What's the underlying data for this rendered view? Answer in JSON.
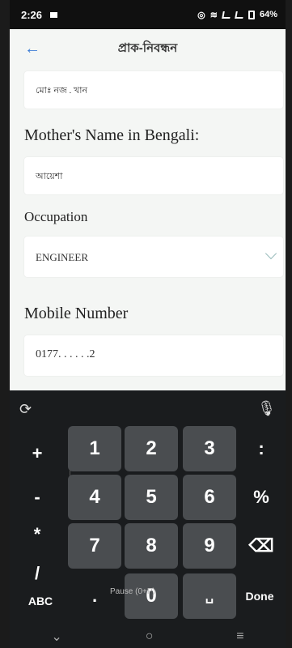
{
  "status_bar": {
    "time": "2:26",
    "battery": "64%"
  },
  "app_bar": {
    "title": "প্রাক-নিবন্ধন"
  },
  "form": {
    "father_name_value": "মোঃ নজ . খান",
    "mother_label": "Mother's Name in Bengali:",
    "mother_value": "আয়েশা",
    "occupation_label": "Occupation",
    "occupation_value": "ENGINEER",
    "mobile_label": "Mobile Number",
    "mobile_value": "0177. . . . . .2"
  },
  "keyboard": {
    "keys": [
      "1",
      "2",
      "3",
      "4",
      "5",
      "6",
      "7",
      "8",
      "9",
      "0"
    ],
    "left": [
      "+",
      "-",
      "*",
      "/"
    ],
    "right": [
      ":",
      "%"
    ],
    "abc": "ABC",
    "dot": ".",
    "done": "Done",
    "tooltip": "Pause (0+P)"
  },
  "icons": {
    "back": "arrow-left-icon",
    "mic": "mic-icon",
    "backspace": "backspace-icon",
    "emoji": "keyboard-toggle-icon"
  }
}
